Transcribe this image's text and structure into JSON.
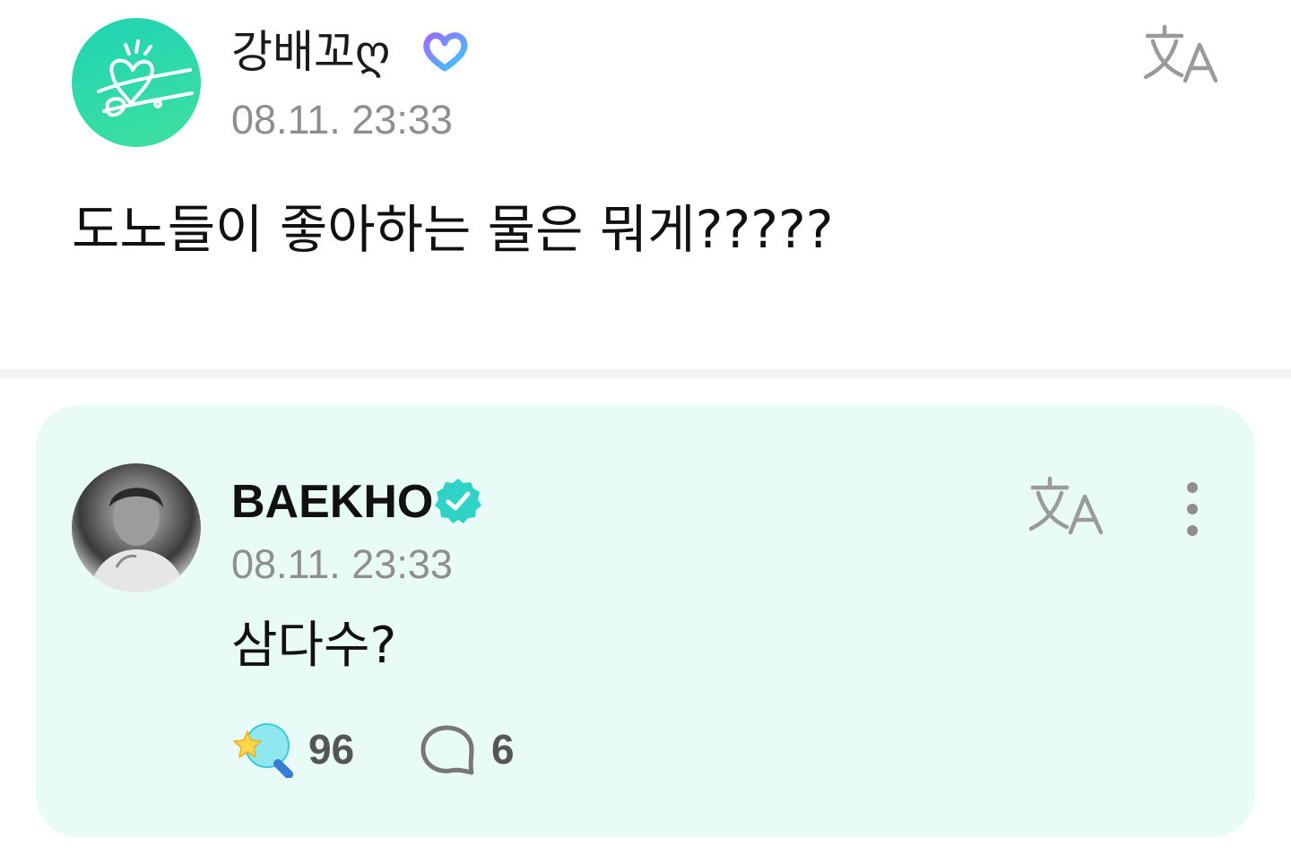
{
  "post": {
    "author": "강배꼬ღ",
    "timestamp": "08.11. 23:33",
    "text": "도노들이 좋아하는 물은 뭐게?????",
    "badge_icon": "membership-heart-icon",
    "avatar_icon": "fan-avatar",
    "translate_icon": "translate-icon"
  },
  "reply": {
    "author": "BAEKHO",
    "timestamp": "08.11. 23:33",
    "text": "삼다수?",
    "verified_icon": "verified-badge-icon",
    "translate_icon": "translate-icon",
    "more_icon": "more-vertical-icon",
    "reaction_count": "96",
    "comment_count": "6"
  },
  "colors": {
    "card_background": "#e9fbf7",
    "accent_teal": "#2fd3c5",
    "timestamp_gray": "#8e8e8e",
    "divider": "#f2f3f5"
  }
}
